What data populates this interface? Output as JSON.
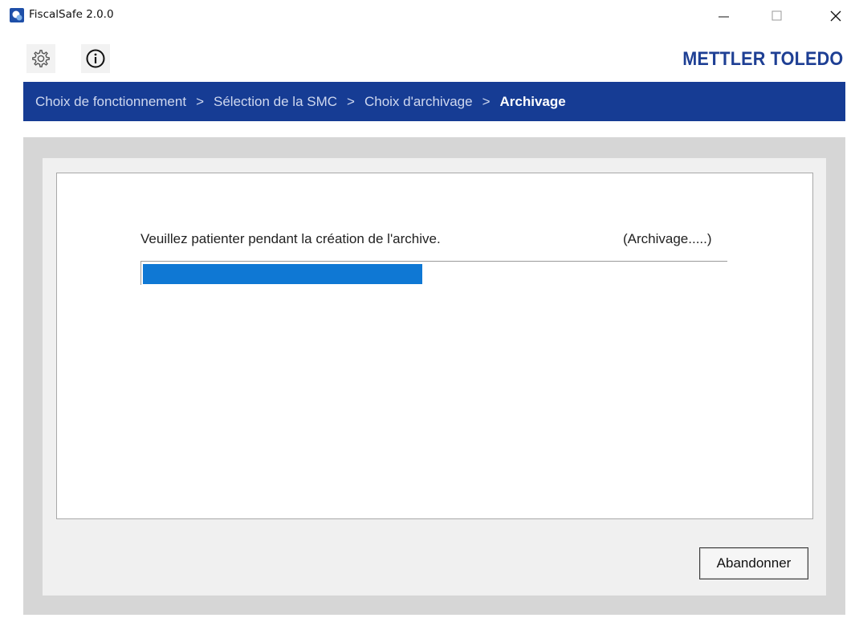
{
  "window": {
    "title": "FiscalSafe 2.0.0",
    "minimize_icon": "minimize-icon",
    "maximize_icon": "maximize-icon",
    "close_icon": "close-icon"
  },
  "toolbar": {
    "settings_icon": "gear-icon",
    "info_icon": "info-icon",
    "brand": "METTLER TOLEDO",
    "brand_color": "#1e3f94"
  },
  "breadcrumb": {
    "items": [
      {
        "label": "Choix de fonctionnement",
        "active": false
      },
      {
        "label": "Sélection de la SMC",
        "active": false
      },
      {
        "label": "Choix d'archivage",
        "active": false
      },
      {
        "label": "Archivage",
        "active": true
      }
    ],
    "separator": ">",
    "bar_color": "#163c94"
  },
  "main": {
    "message": "Veuillez patienter pendant la création de l'archive.",
    "phase": "(Archivage.....)",
    "progress_percent": 48,
    "progress_color": "#0f78d4"
  },
  "footer": {
    "abort_label": "Abandonner"
  }
}
